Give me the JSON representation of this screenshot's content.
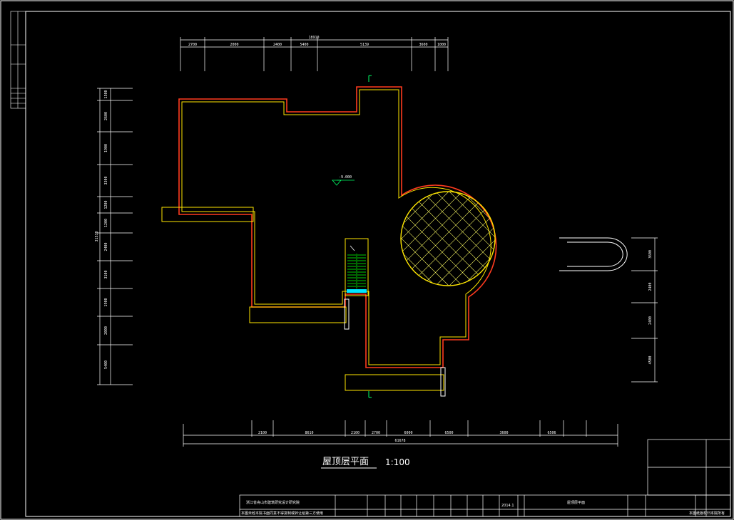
{
  "drawing": {
    "title": "屋顶层平面",
    "scale": "1:100",
    "level_mark": "-9.000",
    "colors": {
      "background": "#000000",
      "frame": "#ffffff",
      "wall_outer": "#ff3b1f",
      "wall_inner": "#ffe600",
      "stair": "#00cc00",
      "stair_landing": "#00e5ff",
      "hatch": "#ffff66"
    }
  },
  "dimensions": {
    "top_total": "18910",
    "top": [
      "2700",
      "2000",
      "2400",
      "5400",
      "5139",
      "3600",
      "1000"
    ],
    "bottom_total": "61678",
    "bottom": [
      "2100",
      "8610",
      "2100",
      "2700",
      "6000",
      "6500",
      "3600",
      "6506"
    ],
    "left_total": "31530",
    "left": [
      "1500",
      "2600",
      "1900",
      "3300",
      "1200",
      "1200",
      "2400",
      "3100",
      "1900",
      "2000",
      "5400"
    ],
    "right": [
      "3600",
      "2400",
      "2400",
      "4500"
    ]
  },
  "title_block": {
    "institute": "浙江省舟山市建筑研究设计研究院",
    "drawing_name": "屋顶层平面",
    "date": "2014.1",
    "footer_note": "本图纸版权归本院所有",
    "bottom_note": "本图未经本院书面同意不得复制或转让给第三方使用"
  }
}
